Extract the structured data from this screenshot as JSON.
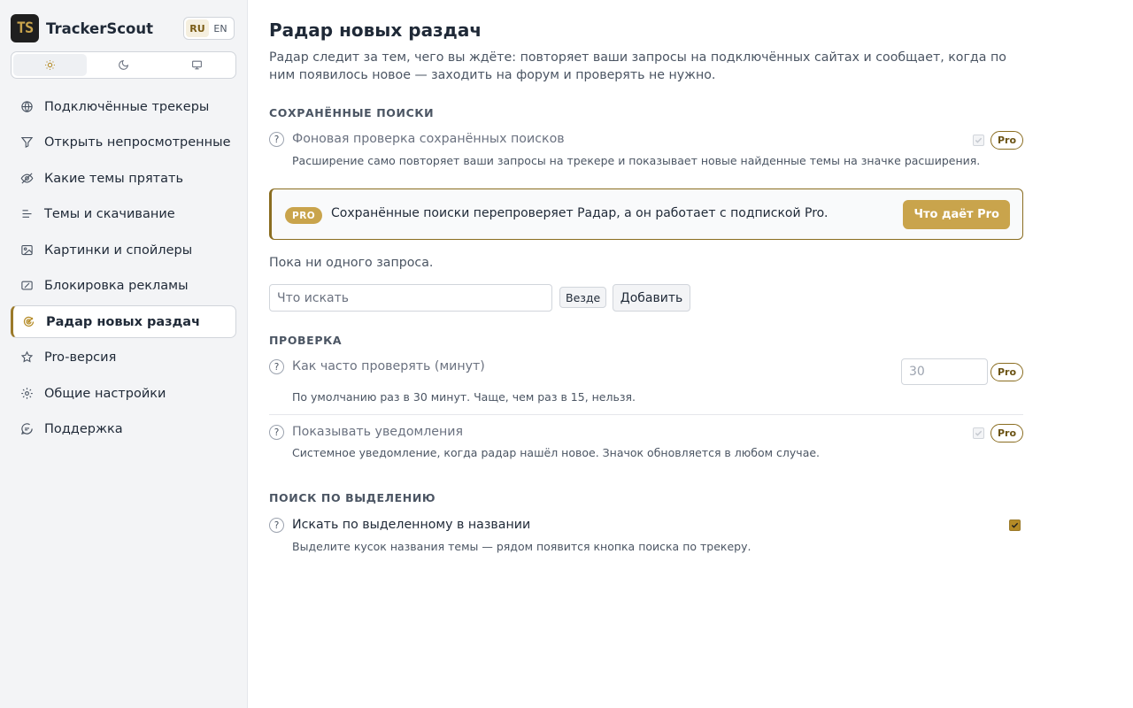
{
  "app": {
    "logo_text": "TS",
    "name": "TrackerScout"
  },
  "lang": {
    "ru": "RU",
    "en": "EN"
  },
  "theme": {
    "light": "sun-icon",
    "dark": "moon-icon",
    "system": "monitor-icon",
    "active": "light"
  },
  "nav": [
    {
      "label": "Подключённые трекеры",
      "icon": "globe-icon"
    },
    {
      "label": "Открыть непросмотренные",
      "icon": "filter-icon"
    },
    {
      "label": "Какие темы прятать",
      "icon": "eye-off-icon"
    },
    {
      "label": "Темы и скачивание",
      "icon": "list-icon"
    },
    {
      "label": "Картинки и спойлеры",
      "icon": "image-icon"
    },
    {
      "label": "Блокировка рекламы",
      "icon": "ad-block-icon"
    },
    {
      "label": "Радар новых раздач",
      "icon": "radar-icon",
      "active": true
    },
    {
      "label": "Pro-версия",
      "icon": "star-icon"
    },
    {
      "label": "Общие настройки",
      "icon": "gear-icon"
    },
    {
      "label": "Поддержка",
      "icon": "chat-icon"
    }
  ],
  "page": {
    "title": "Радар новых раздач",
    "description": "Радар следит за тем, чего вы ждёте: повторяет ваши запросы на подключённых сайтах и сообщает, когда по ним появилось новое — заходить на форум и проверять не нужно."
  },
  "saved_searches": {
    "section_title": "СОХРАНЁННЫЕ ПОИСКИ",
    "background_check": {
      "help": "?",
      "label": "Фоновая проверка сохранённых поисков",
      "desc": "Расширение само повторяет ваши запросы на трекере и показывает новые найденные темы на значке расширения.",
      "badge": "Pro",
      "checked": true,
      "disabled": true
    },
    "promo": {
      "badge": "PRO",
      "text": "Сохранённые поиски перепроверяет Радар, а он работает с подпиской Pro.",
      "button": "Что даёт Pro"
    },
    "empty_text": "Пока ни одного запроса.",
    "search_placeholder": "Что искать",
    "scope": "Везде",
    "add_button": "Добавить"
  },
  "checking": {
    "section_title": "ПРОВЕРКА",
    "interval": {
      "help": "?",
      "label": "Как часто проверять (минут)",
      "value": "30",
      "desc": "По умолчанию раз в 30 минут. Чаще, чем раз в 15, нельзя.",
      "badge": "Pro"
    },
    "notifications": {
      "help": "?",
      "label": "Показывать уведомления",
      "desc": "Системное уведомление, когда радар нашёл новое. Значок обновляется в любом случае.",
      "badge": "Pro",
      "checked": true,
      "disabled": true
    }
  },
  "selection_search": {
    "section_title": "ПОИСК ПО ВЫДЕЛЕНИЮ",
    "by_title": {
      "help": "?",
      "label": "Искать по выделенному в названии",
      "desc": "Выделите кусок названия темы — рядом появится кнопка поиска по трекеру.",
      "checked": true
    }
  },
  "colors": {
    "accent": "#c9a44c",
    "accent_dark": "#8a6d20",
    "sidebar_bg": "#f3f4f6"
  }
}
